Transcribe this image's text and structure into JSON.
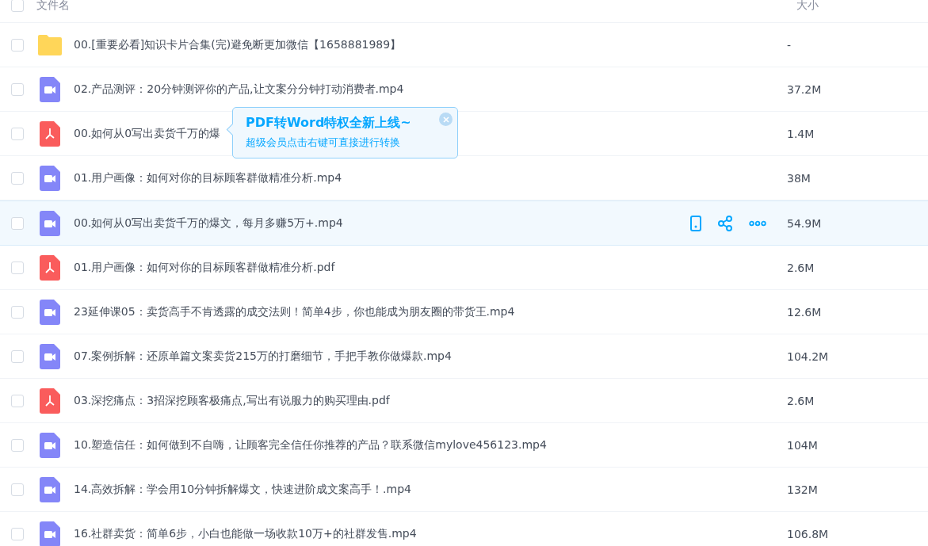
{
  "header": {
    "checked": false,
    "name_label": "文件名",
    "size_label": "大小"
  },
  "files": [
    {
      "kind": "folder",
      "name": "00.[重要必看]知识卡片合集(完)避免断更加微信【1658881989】",
      "size": "-",
      "checked": false,
      "highlighted": false
    },
    {
      "kind": "video",
      "name": "02.产品测评：20分钟测评你的产品,让文案分分钟打动消费者.mp4",
      "size": "37.2M",
      "checked": false,
      "highlighted": false
    },
    {
      "kind": "pdf",
      "name": "00.如何从0写出卖货千万的爆",
      "size": "1.4M",
      "checked": false,
      "highlighted": false
    },
    {
      "kind": "video",
      "name": "01.用户画像：如何对你的目标顾客群做精准分析.mp4",
      "size": "38M",
      "checked": false,
      "highlighted": false
    },
    {
      "kind": "video",
      "name": "00.如何从0写出卖货千万的爆文，每月多赚5万+.mp4",
      "size": "54.9M",
      "checked": false,
      "highlighted": true
    },
    {
      "kind": "pdf",
      "name": "01.用户画像：如何对你的目标顾客群做精准分析.pdf",
      "size": "2.6M",
      "checked": false,
      "highlighted": false
    },
    {
      "kind": "video",
      "name": "23延伸课05：卖货高手不肯透露的成交法则！简单4步，你也能成为朋友圈的带货王.mp4",
      "size": "12.6M",
      "checked": false,
      "highlighted": false
    },
    {
      "kind": "video",
      "name": "07.案例拆解：还原单篇文案卖货215万的打磨细节，手把手教你做爆款.mp4",
      "size": "104.2M",
      "checked": false,
      "highlighted": false
    },
    {
      "kind": "pdf",
      "name": "03.深挖痛点：3招深挖顾客极痛点,写出有说服力的购买理由.pdf",
      "size": "2.6M",
      "checked": false,
      "highlighted": false
    },
    {
      "kind": "video",
      "name": "10.塑造信任：如何做到不自嗨，让顾客完全信任你推荐的产品？联系微信mylove456123.mp4",
      "size": "104M",
      "checked": false,
      "highlighted": false
    },
    {
      "kind": "video",
      "name": "14.高效拆解：学会用10分钟拆解爆文，快速进阶成文案高手！.mp4",
      "size": "132M",
      "checked": false,
      "highlighted": false
    },
    {
      "kind": "video",
      "name": "16.社群卖货：简单6步，小白也能做一场收款10万+的社群发售.mp4",
      "size": "106.8M",
      "checked": false,
      "highlighted": false
    }
  ],
  "tooltip": {
    "title": "PDF转Word特权全新上线~",
    "text": "超级会员点击右键可直接进行转换"
  }
}
